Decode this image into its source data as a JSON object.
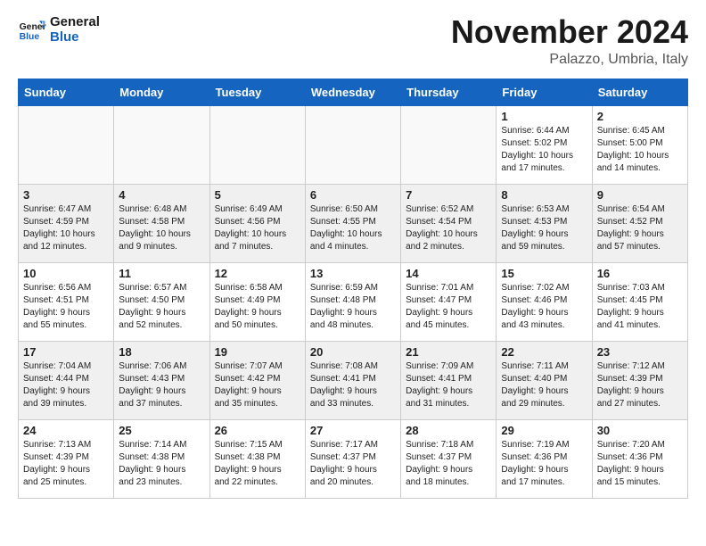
{
  "header": {
    "logo_line1": "General",
    "logo_line2": "Blue",
    "month": "November 2024",
    "location": "Palazzo, Umbria, Italy"
  },
  "weekdays": [
    "Sunday",
    "Monday",
    "Tuesday",
    "Wednesday",
    "Thursday",
    "Friday",
    "Saturday"
  ],
  "weeks": [
    [
      {
        "day": "",
        "info": ""
      },
      {
        "day": "",
        "info": ""
      },
      {
        "day": "",
        "info": ""
      },
      {
        "day": "",
        "info": ""
      },
      {
        "day": "",
        "info": ""
      },
      {
        "day": "1",
        "info": "Sunrise: 6:44 AM\nSunset: 5:02 PM\nDaylight: 10 hours\nand 17 minutes."
      },
      {
        "day": "2",
        "info": "Sunrise: 6:45 AM\nSunset: 5:00 PM\nDaylight: 10 hours\nand 14 minutes."
      }
    ],
    [
      {
        "day": "3",
        "info": "Sunrise: 6:47 AM\nSunset: 4:59 PM\nDaylight: 10 hours\nand 12 minutes."
      },
      {
        "day": "4",
        "info": "Sunrise: 6:48 AM\nSunset: 4:58 PM\nDaylight: 10 hours\nand 9 minutes."
      },
      {
        "day": "5",
        "info": "Sunrise: 6:49 AM\nSunset: 4:56 PM\nDaylight: 10 hours\nand 7 minutes."
      },
      {
        "day": "6",
        "info": "Sunrise: 6:50 AM\nSunset: 4:55 PM\nDaylight: 10 hours\nand 4 minutes."
      },
      {
        "day": "7",
        "info": "Sunrise: 6:52 AM\nSunset: 4:54 PM\nDaylight: 10 hours\nand 2 minutes."
      },
      {
        "day": "8",
        "info": "Sunrise: 6:53 AM\nSunset: 4:53 PM\nDaylight: 9 hours\nand 59 minutes."
      },
      {
        "day": "9",
        "info": "Sunrise: 6:54 AM\nSunset: 4:52 PM\nDaylight: 9 hours\nand 57 minutes."
      }
    ],
    [
      {
        "day": "10",
        "info": "Sunrise: 6:56 AM\nSunset: 4:51 PM\nDaylight: 9 hours\nand 55 minutes."
      },
      {
        "day": "11",
        "info": "Sunrise: 6:57 AM\nSunset: 4:50 PM\nDaylight: 9 hours\nand 52 minutes."
      },
      {
        "day": "12",
        "info": "Sunrise: 6:58 AM\nSunset: 4:49 PM\nDaylight: 9 hours\nand 50 minutes."
      },
      {
        "day": "13",
        "info": "Sunrise: 6:59 AM\nSunset: 4:48 PM\nDaylight: 9 hours\nand 48 minutes."
      },
      {
        "day": "14",
        "info": "Sunrise: 7:01 AM\nSunset: 4:47 PM\nDaylight: 9 hours\nand 45 minutes."
      },
      {
        "day": "15",
        "info": "Sunrise: 7:02 AM\nSunset: 4:46 PM\nDaylight: 9 hours\nand 43 minutes."
      },
      {
        "day": "16",
        "info": "Sunrise: 7:03 AM\nSunset: 4:45 PM\nDaylight: 9 hours\nand 41 minutes."
      }
    ],
    [
      {
        "day": "17",
        "info": "Sunrise: 7:04 AM\nSunset: 4:44 PM\nDaylight: 9 hours\nand 39 minutes."
      },
      {
        "day": "18",
        "info": "Sunrise: 7:06 AM\nSunset: 4:43 PM\nDaylight: 9 hours\nand 37 minutes."
      },
      {
        "day": "19",
        "info": "Sunrise: 7:07 AM\nSunset: 4:42 PM\nDaylight: 9 hours\nand 35 minutes."
      },
      {
        "day": "20",
        "info": "Sunrise: 7:08 AM\nSunset: 4:41 PM\nDaylight: 9 hours\nand 33 minutes."
      },
      {
        "day": "21",
        "info": "Sunrise: 7:09 AM\nSunset: 4:41 PM\nDaylight: 9 hours\nand 31 minutes."
      },
      {
        "day": "22",
        "info": "Sunrise: 7:11 AM\nSunset: 4:40 PM\nDaylight: 9 hours\nand 29 minutes."
      },
      {
        "day": "23",
        "info": "Sunrise: 7:12 AM\nSunset: 4:39 PM\nDaylight: 9 hours\nand 27 minutes."
      }
    ],
    [
      {
        "day": "24",
        "info": "Sunrise: 7:13 AM\nSunset: 4:39 PM\nDaylight: 9 hours\nand 25 minutes."
      },
      {
        "day": "25",
        "info": "Sunrise: 7:14 AM\nSunset: 4:38 PM\nDaylight: 9 hours\nand 23 minutes."
      },
      {
        "day": "26",
        "info": "Sunrise: 7:15 AM\nSunset: 4:38 PM\nDaylight: 9 hours\nand 22 minutes."
      },
      {
        "day": "27",
        "info": "Sunrise: 7:17 AM\nSunset: 4:37 PM\nDaylight: 9 hours\nand 20 minutes."
      },
      {
        "day": "28",
        "info": "Sunrise: 7:18 AM\nSunset: 4:37 PM\nDaylight: 9 hours\nand 18 minutes."
      },
      {
        "day": "29",
        "info": "Sunrise: 7:19 AM\nSunset: 4:36 PM\nDaylight: 9 hours\nand 17 minutes."
      },
      {
        "day": "30",
        "info": "Sunrise: 7:20 AM\nSunset: 4:36 PM\nDaylight: 9 hours\nand 15 minutes."
      }
    ]
  ]
}
